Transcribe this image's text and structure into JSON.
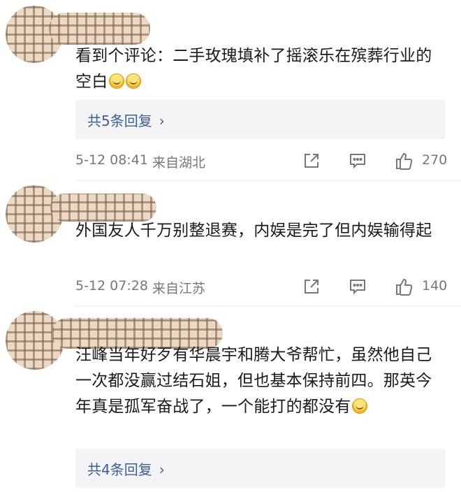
{
  "comments": [
    {
      "text": "看到个评论：二手玫瑰填补了摇滚乐在殡葬行业的空白",
      "reply_label": "共5条回复",
      "time": "5-12 08:41",
      "location": "来自湖北",
      "likes": "270"
    },
    {
      "text": "外国友人千万别整退赛，内娱是完了但内娱输得起",
      "time": "5-12 07:28",
      "location": "来自江苏",
      "likes": "140"
    },
    {
      "text": "汪峰当年好歹有华晨宇和腾大爷帮忙，虽然他自己一次都没赢过结石姐，但也基本保持前四。那英今年真是孤军奋战了，一个能打的都没有",
      "reply_label": "共4条回复"
    }
  ],
  "icons": {
    "share": "share-icon",
    "comment": "comment-icon",
    "like": "thumbs-up-icon",
    "chevron": "chevron-right-icon",
    "emoji": "laugh-cry-emoji-icon"
  },
  "colors": {
    "link": "#3a5f99",
    "meta": "#777777",
    "reply_bg": "#f4f4f6"
  }
}
